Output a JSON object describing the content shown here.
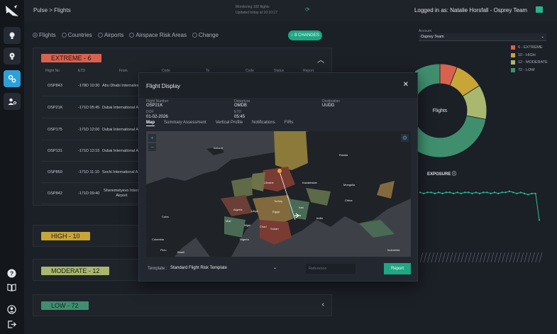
{
  "sidebar": {
    "items": [
      {
        "icon": "bulb-icon"
      },
      {
        "icon": "bulb-alert-icon"
      },
      {
        "icon": "settings-gears-icon",
        "active": true
      },
      {
        "icon": "user-settings-icon"
      }
    ],
    "bottom": [
      {
        "icon": "help-icon"
      },
      {
        "icon": "book-icon"
      },
      {
        "icon": "user-icon"
      },
      {
        "icon": "logout-icon"
      }
    ]
  },
  "topbar": {
    "breadcrumb": "Pulse > Flights",
    "monitoring_line1": "Monitoring 100 flights",
    "monitoring_line2": "Updated today at 10:10:17",
    "login_text": "Logged in as: Natalie Horsfall - Osprey Team"
  },
  "filters": {
    "options": [
      "Flights",
      "Countries",
      "Airports",
      "Airspace Risk Areas",
      "Change"
    ],
    "selected": "Flights",
    "changes_label": "8 CHANGES"
  },
  "groups": [
    {
      "label": "EXTREME - 6",
      "color": "#d9624f"
    },
    {
      "label": "HIGH - 10",
      "color": "#c9a436"
    },
    {
      "label": "MODERATE - 12",
      "color": "#a8b86e"
    },
    {
      "label": "LOW - 72",
      "color": "#3f8f6e"
    }
  ],
  "table": {
    "columns": [
      "Flight No",
      "ETD",
      "From",
      "Code",
      "To",
      "Code",
      "Status",
      "Report"
    ],
    "rows": [
      {
        "flight": "OSP843",
        "etd": "-178D 10:30",
        "from": "Abu Dhabi International"
      },
      {
        "flight": "OSP21K",
        "etd": "-171D 05:45",
        "from": "Dubai International A"
      },
      {
        "flight": "OSP175",
        "etd": "-171D 12:00",
        "from": "Dubai International A"
      },
      {
        "flight": "OSP131",
        "etd": "-171D 12:15",
        "from": "Dubai International A"
      },
      {
        "flight": "OSP859",
        "etd": "-171D 11:10",
        "from": "Sochi International A"
      },
      {
        "flight": "OSP842",
        "etd": "-171D 09:40",
        "from": "Sheremetyevo Intern Airport"
      }
    ]
  },
  "account": {
    "label": "Account",
    "value": "Osprey Team"
  },
  "legend": [
    {
      "label": "6 - EXTREME",
      "color": "#d9624f"
    },
    {
      "label": "10 - HIGH",
      "color": "#c9a436"
    },
    {
      "label": "12 - MODERATE",
      "color": "#a8b86e"
    },
    {
      "label": "72 - LOW",
      "color": "#3f8f6e"
    }
  ],
  "donut_label": "Flights",
  "exposure_label": "EXPOSURE",
  "chart_data": {
    "type": "pie",
    "labels": [
      "EXTREME",
      "HIGH",
      "MODERATE",
      "LOW"
    ],
    "values": [
      6,
      10,
      12,
      72
    ],
    "colors": [
      "#d9624f",
      "#c9a436",
      "#a8b86e",
      "#3f8f6e"
    ]
  },
  "exposure_data": {
    "type": "line",
    "values": [
      99,
      98,
      99,
      99,
      98,
      99,
      98,
      99,
      99,
      98,
      99,
      98,
      99,
      99,
      98,
      99,
      98,
      99,
      99,
      98,
      99,
      98,
      99,
      99,
      100,
      99,
      98,
      99,
      98,
      97,
      98,
      98,
      74
    ]
  },
  "modal": {
    "title": "Flight Display",
    "flight_number_label": "Flight Number",
    "flight_number": "OSP21K",
    "dof_label": "DOF",
    "dof": "01-02-2026",
    "departure_label": "Departure",
    "departure": "OMDB",
    "etd_label": "ETD",
    "etd": "05:45",
    "destination_label": "Destination",
    "destination": "UUDD",
    "tabs": [
      "Map",
      "Summary Assessment",
      "Vertical Profile",
      "Notifications",
      "FIRs"
    ],
    "active_tab": "Map",
    "template_label": "Template :",
    "template_value": "Standard Flight Risk Template",
    "reference_placeholder": "Reference",
    "report_button": "Report",
    "map_labels": [
      {
        "text": "Iceland"
      },
      {
        "text": "Russia"
      },
      {
        "text": "Kazakhstan"
      },
      {
        "text": "Mongolia"
      },
      {
        "text": "China"
      },
      {
        "text": "India"
      },
      {
        "text": "Algeria"
      },
      {
        "text": "Libya"
      },
      {
        "text": "Egypt"
      },
      {
        "text": "Sudan"
      },
      {
        "text": "Niger"
      },
      {
        "text": "Nigeria"
      },
      {
        "text": "Cuba"
      },
      {
        "text": "Colombia"
      },
      {
        "text": "Brazil"
      },
      {
        "text": "Indonesia"
      },
      {
        "text": "Ukraine"
      },
      {
        "text": "Turkey"
      },
      {
        "text": "Iran"
      },
      {
        "text": "Mali"
      },
      {
        "text": "Chad"
      },
      {
        "text": "Peru"
      }
    ]
  }
}
